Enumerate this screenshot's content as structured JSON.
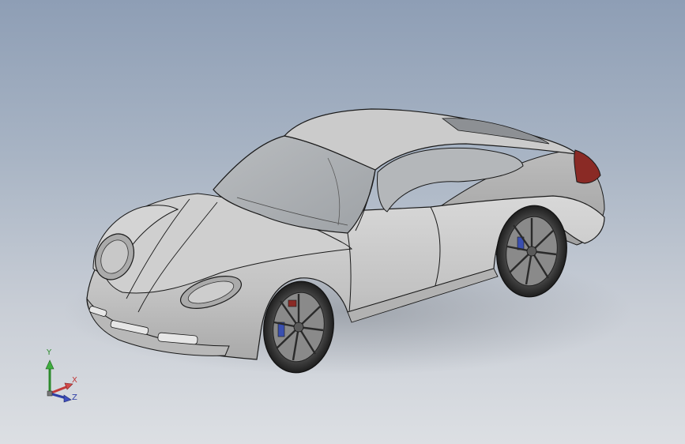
{
  "viewport": {
    "background_top": "#8e9eb5",
    "background_bottom": "#dcdfe3"
  },
  "model": {
    "body_color": "#c4c4c4",
    "edge_color": "#1a1a1a",
    "taillight_color": "#8a2a25",
    "brake_caliper_color": "#3a4fb0",
    "wheel_count": 2
  },
  "triad": {
    "x_label": "X",
    "y_label": "Y",
    "z_label": "Z",
    "x_color": "#c23a3a",
    "y_color": "#2d8a2d",
    "z_color": "#2f3fa6"
  }
}
